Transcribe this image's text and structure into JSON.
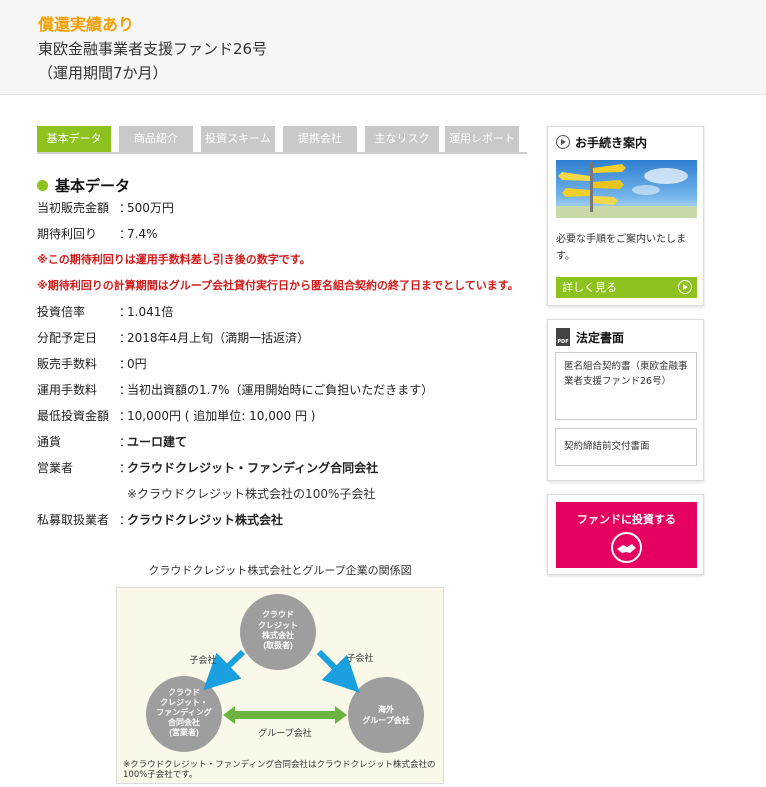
{
  "hero": {
    "badge": "償還実績あり",
    "title_line1": "東欧金融事業者支援ファンド26号",
    "title_line2": "（運用期間7か月）"
  },
  "tabs": [
    {
      "label": "基本データ",
      "active": true
    },
    {
      "label": "商品紹介",
      "active": false
    },
    {
      "label": "投資スキーム",
      "active": false
    },
    {
      "label": "提携会社",
      "active": false
    },
    {
      "label": "主なリスク",
      "active": false
    },
    {
      "label": "運用レポート",
      "active": false
    }
  ],
  "basic": {
    "section_title": "基本データ",
    "colon": "：",
    "initial_sales": {
      "label": "当初販売金額",
      "value": "500万円"
    },
    "expected_yield": {
      "label": "期待利回り",
      "value": "7.4%"
    },
    "note1": "※この期待利回りは運用手数料差し引き後の数字です。",
    "note2": "※期待利回りの計算期間はグループ会社貸付実行日から匿名組合契約の終了日までとしています。",
    "multiple": {
      "label": "投資倍率",
      "value": "1.041倍"
    },
    "distribution_date": {
      "label": "分配予定日",
      "value": "2018年4月上旬（満期一括返済）"
    },
    "sales_fee": {
      "label": "販売手数料",
      "value": "0円"
    },
    "management_fee": {
      "label": "運用手数料",
      "value": "当初出資額の1.7%（運用開始時にご負担いただきます）"
    },
    "min_investment": {
      "label": "最低投資金額",
      "value": "10,000円 ( 追加単位: 10,000 円 )"
    },
    "currency": {
      "label": "通貨",
      "value": "ユーロ建て"
    },
    "operator": {
      "label": "営業者",
      "value": "クラウドクレジット・ファンディング合同会社"
    },
    "operator_note": "※クラウドクレジット株式会社の100%子会社",
    "placement_agent": {
      "label": "私募取扱業者",
      "value": "クラウドクレジット株式会社"
    }
  },
  "diagram": {
    "caption": "クラウドクレジット株式会社とグループ企業の関係図",
    "node_top": [
      "クラウド",
      "クレジット",
      "株式会社",
      "(取扱者)"
    ],
    "node_left": [
      "クラウド",
      "クレジット・",
      "ファンディング",
      "合同会社",
      "(営業者)"
    ],
    "node_right": [
      "海外",
      "グループ会社"
    ],
    "label_left": "子会社",
    "label_right": "子会社",
    "label_bottom": "グループ会社",
    "footnote": "※クラウドクレジット・ファンディング合同会社はクラウドクレジット株式会社の100%子会社です。"
  },
  "sidebar": {
    "procedure": {
      "title": "お手続き案内",
      "desc": "必要な手順をご案内いたします。",
      "more_label": "詳しく見る"
    },
    "legal": {
      "title": "法定書面",
      "doc1": "匿名組合契約書（東欧金融事業者支援ファンド26号）",
      "doc2": "契約締結前交付書面"
    },
    "invest_label": "ファンドに投資する"
  },
  "colors": {
    "accent_green": "#8dc21f",
    "badge_orange": "#f5a000",
    "note_red": "#d21b1b",
    "invest_pink": "#e60060",
    "arrow_blue": "#1aa0e0",
    "arrow_green": "#6cb33f"
  }
}
